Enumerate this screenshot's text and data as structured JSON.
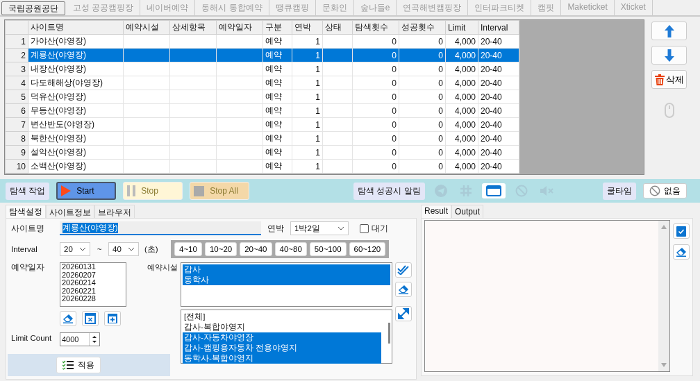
{
  "site_tabs": [
    {
      "label": "국립공원공단",
      "selected": true
    },
    {
      "label": "고성 공공캠핑장",
      "selected": false
    },
    {
      "label": "네이버예약",
      "selected": false
    },
    {
      "label": "동해시 통합예약",
      "selected": false
    },
    {
      "label": "땡큐캠핑",
      "selected": false
    },
    {
      "label": "문화인",
      "selected": false
    },
    {
      "label": "숲나들e",
      "selected": false
    },
    {
      "label": "연곡해변캠핑장",
      "selected": false
    },
    {
      "label": "인터파크티켓",
      "selected": false
    },
    {
      "label": "캠핏",
      "selected": false
    },
    {
      "label": "Maketicket",
      "selected": false
    },
    {
      "label": "Xticket",
      "selected": false
    }
  ],
  "table": {
    "columns": [
      "사이트명",
      "예약시설",
      "상세항목",
      "예약일자",
      "구분",
      "연박",
      "상태",
      "탐색횟수",
      "성공횟수",
      "Limit",
      "Interval"
    ],
    "rows": [
      {
        "num": "1",
        "cells": [
          "가야산(야영장)",
          null,
          null,
          null,
          "예약",
          "1",
          null,
          "0",
          "0",
          "4,000",
          "20-40"
        ],
        "selected": false
      },
      {
        "num": "2",
        "cells": [
          "계룡산(야영장)",
          null,
          null,
          null,
          "예약",
          "1",
          null,
          "0",
          "0",
          "4,000",
          "20-40"
        ],
        "selected": true
      },
      {
        "num": "3",
        "cells": [
          "내장산(야영장)",
          null,
          null,
          null,
          "예약",
          "1",
          null,
          "0",
          "0",
          "4,000",
          "20-40"
        ],
        "selected": false
      },
      {
        "num": "4",
        "cells": [
          "다도해해상(야영장)",
          null,
          null,
          null,
          "예약",
          "1",
          null,
          "0",
          "0",
          "4,000",
          "20-40"
        ],
        "selected": false
      },
      {
        "num": "5",
        "cells": [
          "덕유산(야영장)",
          null,
          null,
          null,
          "예약",
          "1",
          null,
          "0",
          "0",
          "4,000",
          "20-40"
        ],
        "selected": false
      },
      {
        "num": "6",
        "cells": [
          "무등산(야영장)",
          null,
          null,
          null,
          "예약",
          "1",
          null,
          "0",
          "0",
          "4,000",
          "20-40"
        ],
        "selected": false
      },
      {
        "num": "7",
        "cells": [
          "변산반도(야영장)",
          null,
          null,
          null,
          "예약",
          "1",
          null,
          "0",
          "0",
          "4,000",
          "20-40"
        ],
        "selected": false
      },
      {
        "num": "8",
        "cells": [
          "북한산(야영장)",
          null,
          null,
          null,
          "예약",
          "1",
          null,
          "0",
          "0",
          "4,000",
          "20-40"
        ],
        "selected": false
      },
      {
        "num": "9",
        "cells": [
          "설악산(야영장)",
          null,
          null,
          null,
          "예약",
          "1",
          null,
          "0",
          "0",
          "4,000",
          "20-40"
        ],
        "selected": false
      },
      {
        "num": "10",
        "cells": [
          "소백산(야영장)",
          null,
          null,
          null,
          "예약",
          "1",
          null,
          "0",
          "0",
          "4,000",
          "20-40"
        ],
        "selected": false
      }
    ]
  },
  "side_buttons": {
    "delete_label": "삭제"
  },
  "toolbar": {
    "task_label": "탐색 작업",
    "controls": [
      {
        "kind": "start",
        "label": "Start"
      },
      {
        "kind": "stop",
        "label": "Stop"
      },
      {
        "kind": "stopall",
        "label": "Stop All"
      }
    ],
    "alert_label": "탐색 성공시 알림",
    "alerts": [
      {
        "kind": "send",
        "disabled": true
      },
      {
        "kind": "hash",
        "disabled": true
      },
      {
        "kind": "window",
        "disabled": false
      },
      {
        "kind": "ban",
        "disabled": true
      },
      {
        "kind": "mute",
        "disabled": true
      }
    ],
    "cooldown_label": "쿨타임",
    "cooldown_value": "없음"
  },
  "settings_tabs": [
    {
      "label": "탐색설정",
      "selected": true
    },
    {
      "label": "사이트정보",
      "selected": false
    },
    {
      "label": "브라우저",
      "selected": false
    }
  ],
  "form": {
    "site_label": "사이트명",
    "site_value": "계룡산(야영장)",
    "site_text_selected": true,
    "stay_label": "연박",
    "stay_value": "1박2일",
    "wait": {
      "label": "대기",
      "checked": false
    },
    "interval_label": "Interval",
    "interval_from": "20",
    "interval_sep": "~",
    "interval_to": "40",
    "interval_unit": "(초)",
    "presets": [
      "4~10",
      "10~20",
      "20~40",
      "40~80",
      "50~100",
      "60~120"
    ],
    "date_label": "예약일자",
    "dates": [
      "20260131",
      "20260207",
      "20260214",
      "20260221",
      "20260228"
    ],
    "facility_label": "예약시설",
    "facilities": [
      "갑사",
      "동학사"
    ],
    "facility_options": [
      {
        "label": "[전체]",
        "selected": false
      },
      {
        "label": "갑사-복합야영지",
        "selected": false
      },
      {
        "label": "갑사-자동차야영장",
        "selected": true
      },
      {
        "label": "갑사-캠핑용자동차 전용야영지",
        "selected": true
      },
      {
        "label": "동학사-복합야영지",
        "selected": true
      }
    ],
    "limit_label": "Limit Count",
    "limit_value": "4000",
    "apply_label": "적용"
  },
  "output_tabs": [
    {
      "label": "Result",
      "selected": true
    },
    {
      "label": "Output",
      "selected": false
    }
  ]
}
